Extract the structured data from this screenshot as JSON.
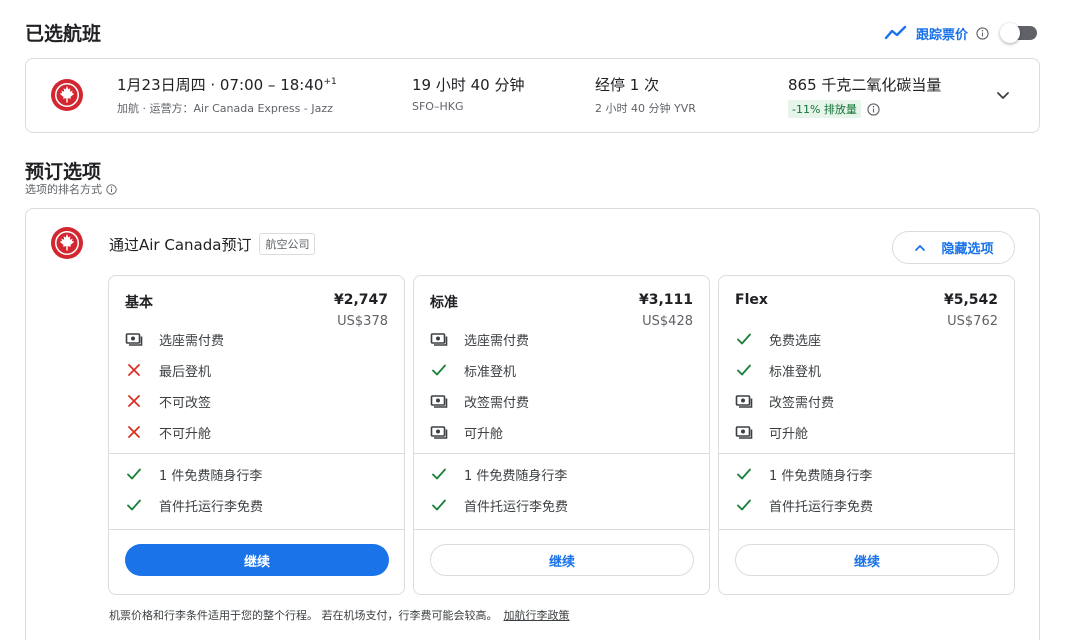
{
  "selected": {
    "title": "已选航班",
    "track_label": "跟踪票价",
    "flight": {
      "datetime": "1月23日周四 · 07:00 – 18:40",
      "day_offset": "+1",
      "operator": "加航 · 运营方：Air Canada Express - Jazz",
      "duration": "19 小时 40 分钟",
      "route": "SFO–HKG",
      "stops": "经停 1 次",
      "layover": "2 小时 40 分钟 YVR",
      "emissions": "865 千克二氧化碳当量",
      "emission_badge": "-11% 排放量"
    }
  },
  "booking": {
    "title": "预订选项",
    "sort_label": "选项的排名方式",
    "provider": "通过Air Canada预订",
    "provider_tag": "航空公司",
    "hide_label": "隐藏选项",
    "fares": [
      {
        "name": "基本",
        "price": "¥2,747",
        "usd": "US$378",
        "features": [
          {
            "icon": "money-icon",
            "text": "选座需付费"
          },
          {
            "icon": "cross-icon",
            "text": "最后登机"
          },
          {
            "icon": "cross-icon",
            "text": "不可改签"
          },
          {
            "icon": "cross-icon",
            "text": "不可升舱"
          }
        ],
        "bags": [
          {
            "icon": "check-icon",
            "text": "1 件免费随身行李"
          },
          {
            "icon": "check-icon",
            "text": "首件托运行李免费"
          }
        ],
        "button": "继续"
      },
      {
        "name": "标准",
        "price": "¥3,111",
        "usd": "US$428",
        "features": [
          {
            "icon": "money-icon",
            "text": "选座需付费"
          },
          {
            "icon": "check-icon",
            "text": "标准登机"
          },
          {
            "icon": "money-icon",
            "text": "改签需付费"
          },
          {
            "icon": "money-icon",
            "text": "可升舱"
          }
        ],
        "bags": [
          {
            "icon": "check-icon",
            "text": "1 件免费随身行李"
          },
          {
            "icon": "check-icon",
            "text": "首件托运行李免费"
          }
        ],
        "button": "继续"
      },
      {
        "name": "Flex",
        "price": "¥5,542",
        "usd": "US$762",
        "features": [
          {
            "icon": "check-icon",
            "text": "免费选座"
          },
          {
            "icon": "check-icon",
            "text": "标准登机"
          },
          {
            "icon": "money-icon",
            "text": "改签需付费"
          },
          {
            "icon": "money-icon",
            "text": "可升舱"
          }
        ],
        "bags": [
          {
            "icon": "check-icon",
            "text": "1 件免费随身行李"
          },
          {
            "icon": "check-icon",
            "text": "首件托运行李免费"
          }
        ],
        "button": "继续"
      }
    ],
    "footer_note": "机票价格和行李条件适用于您的整个行程。 若在机场支付，行李费可能会较高。",
    "footer_link": "加航行李政策"
  },
  "colors": {
    "accent": "#1a73e8",
    "airline_red": "#d22630",
    "check_green": "#188038",
    "cross_red": "#d93025"
  }
}
